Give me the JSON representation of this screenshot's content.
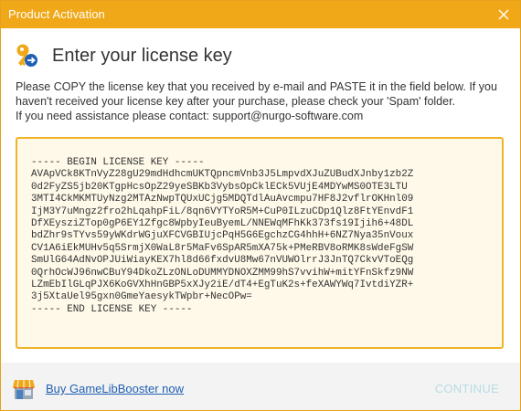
{
  "window": {
    "title": "Product Activation",
    "accent": "#f0a818"
  },
  "header": {
    "title": "Enter your license key",
    "icon": "key-icon"
  },
  "description": {
    "line1": "Please COPY the license key that you received by e-mail and PASTE it in the field below. If you haven't received your license key after your purchase, please check your 'Spam' folder.",
    "line2": "If you need assistance please contact: support@nurgo-software.com"
  },
  "license": {
    "text": "----- BEGIN LICENSE KEY -----\nAVApVCk8KTnVyZ28gU29mdHdhcmUKTQpncmVnb3J5LmpvdXJuZUBudXJnby1zb2Z\n0d2FyZS5jb20KTgpHcsOpZ29yeSBKb3VybsOpCklECk5VUjE4MDYwMS0OTE3LTU\n3MTI4CkMKMTUyNzg2MTAzNwpTQUxUCjg5MDQTdlAuAvcmpu7HF8J2vflrOKHnl09\nIjM3Y7uMngz2fro2hLqahpFiL/8qn6VYTYoR5M+CuP0ILzuCDp1Qlz8FtYEnvdF1\nDfXEysziZTop0gP6EY1Zfgc8WpbyIeuByemL/NNEWqMFhKk373fs19Ijih6+48DL\nbdZhr9sTYvs59yWKdrWGjuXFCVGBIUjcPqH5G6EgchzCG4hhH+6NZ7Nya35nVoux\nCV1A6iEkMUHv5q5SrmjX0WaL8r5MaFv6SpAR5mXA75k+PMeRBV8oRMK8sWdeFgSW\nSmUlG64AdNvOPJUiWiayKEX7hl8d66fxdvU8Mw67nVUWOlrrJ3JnTQ7CkvVToEQg\n0QrhOcWJ96nwCBuY94DkoZLzONLoDUMMYDNOXZMM99hS7vvihW+mitYFnSkfz9NW\nLZmEbIlGLqPJX6KoGVXhHnGBP5xXJy2iE/dT4+EgTuK2s+feXAWYWq7IvtdiYZR+\n3j5XtaUel95gxn0GmeYaesykTWpbr+NecOPw=\n----- END LICENSE KEY -----"
  },
  "footer": {
    "buy_link": "Buy GameLibBooster now",
    "continue_label": "CONTINUE",
    "store_icon": "store-icon"
  }
}
